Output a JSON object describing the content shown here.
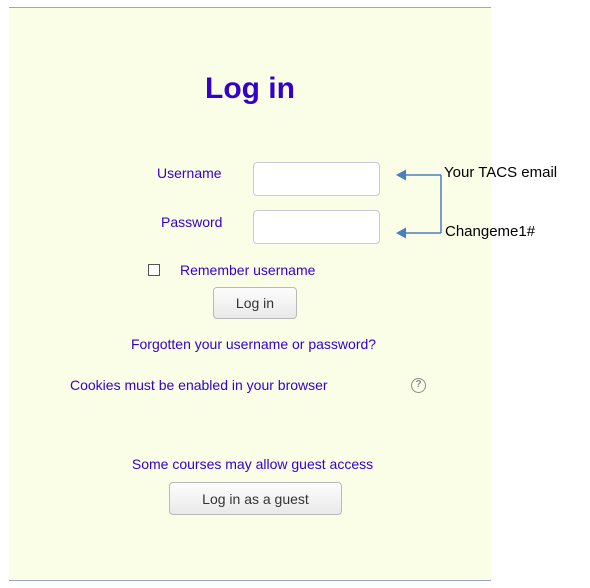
{
  "login": {
    "title": "Log in",
    "username_label": "Username",
    "username_value": "",
    "password_label": "Password",
    "password_value": "",
    "remember_label": "Remember username",
    "remember_checked": false,
    "login_button": "Log in",
    "forgot_link": "Forgotten your username or password?",
    "cookies_text": "Cookies must be enabled in your browser",
    "help_icon": "question-circle-icon",
    "guest_text": "Some courses may allow guest access",
    "guest_button": "Log in as a guest"
  },
  "annotations": {
    "username_hint": "Your TACS email",
    "password_hint": "Changeme1#",
    "arrow_color": "#4a7ebf"
  },
  "colors": {
    "panel_background": "#fbfee6",
    "accent_text": "#3300cc"
  }
}
